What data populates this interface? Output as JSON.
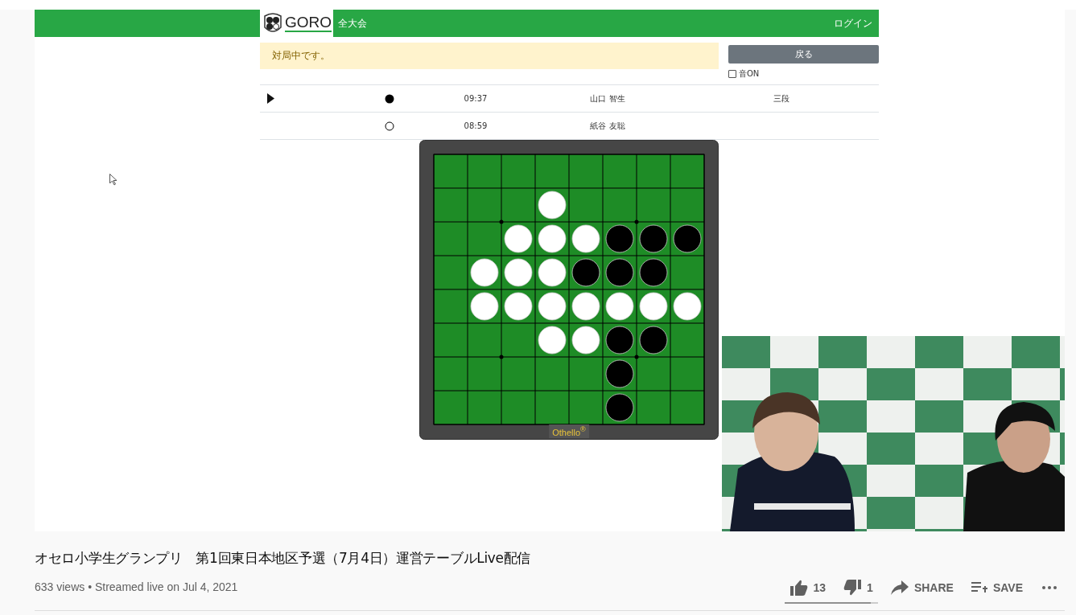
{
  "goro": {
    "logo_text": "GORO",
    "nav_item": "全大会",
    "login": "ログイン",
    "alert": "対局中です。",
    "back_button": "戻る",
    "sound": {
      "label": "音ON",
      "checked": false
    },
    "players": [
      {
        "to_move": true,
        "kind": "black",
        "time": "09:37",
        "name": "山口 智生",
        "rank": "三段"
      },
      {
        "to_move": false,
        "kind": "white",
        "time": "08:59",
        "name": "紙谷 友聡"
      }
    ],
    "board": {
      "label": "Othello$^{®}$",
      "rows": [
        {
          "cells": [
            {
              "kind": "empty"
            },
            {
              "kind": "empty"
            },
            {
              "kind": "empty"
            },
            {
              "kind": "empty"
            },
            {
              "kind": "empty"
            },
            {
              "kind": "empty"
            },
            {
              "kind": "empty"
            },
            {
              "kind": "empty"
            }
          ]
        },
        {
          "cells": [
            {
              "kind": "empty"
            },
            {
              "kind": "empty"
            },
            {
              "kind": "empty"
            },
            {
              "kind": "white"
            },
            {
              "kind": "empty"
            },
            {
              "kind": "empty"
            },
            {
              "kind": "empty"
            },
            {
              "kind": "empty"
            }
          ]
        },
        {
          "cells": [
            {
              "kind": "empty"
            },
            {
              "kind": "empty"
            },
            {
              "kind": "white"
            },
            {
              "kind": "white"
            },
            {
              "kind": "white"
            },
            {
              "kind": "black"
            },
            {
              "kind": "black"
            },
            {
              "kind": "black"
            }
          ]
        },
        {
          "cells": [
            {
              "kind": "empty"
            },
            {
              "kind": "white"
            },
            {
              "kind": "white"
            },
            {
              "kind": "white"
            },
            {
              "kind": "black"
            },
            {
              "kind": "black"
            },
            {
              "kind": "black"
            },
            {
              "kind": "empty"
            }
          ]
        },
        {
          "cells": [
            {
              "kind": "empty"
            },
            {
              "kind": "white"
            },
            {
              "kind": "white"
            },
            {
              "kind": "white"
            },
            {
              "kind": "white"
            },
            {
              "kind": "white"
            },
            {
              "kind": "white"
            },
            {
              "kind": "white"
            }
          ]
        },
        {
          "cells": [
            {
              "kind": "empty"
            },
            {
              "kind": "empty"
            },
            {
              "kind": "empty"
            },
            {
              "kind": "white"
            },
            {
              "kind": "white"
            },
            {
              "kind": "black"
            },
            {
              "kind": "black"
            },
            {
              "kind": "empty"
            }
          ]
        },
        {
          "cells": [
            {
              "kind": "empty"
            },
            {
              "kind": "empty"
            },
            {
              "kind": "empty"
            },
            {
              "kind": "empty"
            },
            {
              "kind": "empty"
            },
            {
              "kind": "black"
            },
            {
              "kind": "empty"
            },
            {
              "kind": "empty"
            }
          ]
        },
        {
          "cells": [
            {
              "kind": "empty"
            },
            {
              "kind": "empty"
            },
            {
              "kind": "empty"
            },
            {
              "kind": "empty"
            },
            {
              "kind": "empty"
            },
            {
              "kind": "black"
            },
            {
              "kind": "empty"
            },
            {
              "kind": "empty"
            }
          ]
        }
      ]
    }
  },
  "video": {
    "title": "オセロ小学生グランプリ　第1回東日本地区予選（7月4日）運営テーブルLive配信",
    "meta": "633 views • Streamed live on Jul 4, 2021",
    "likes": "13",
    "dislikes": "1",
    "rating": {
      "level": 0.93
    },
    "share": "SHARE",
    "save": "SAVE"
  }
}
